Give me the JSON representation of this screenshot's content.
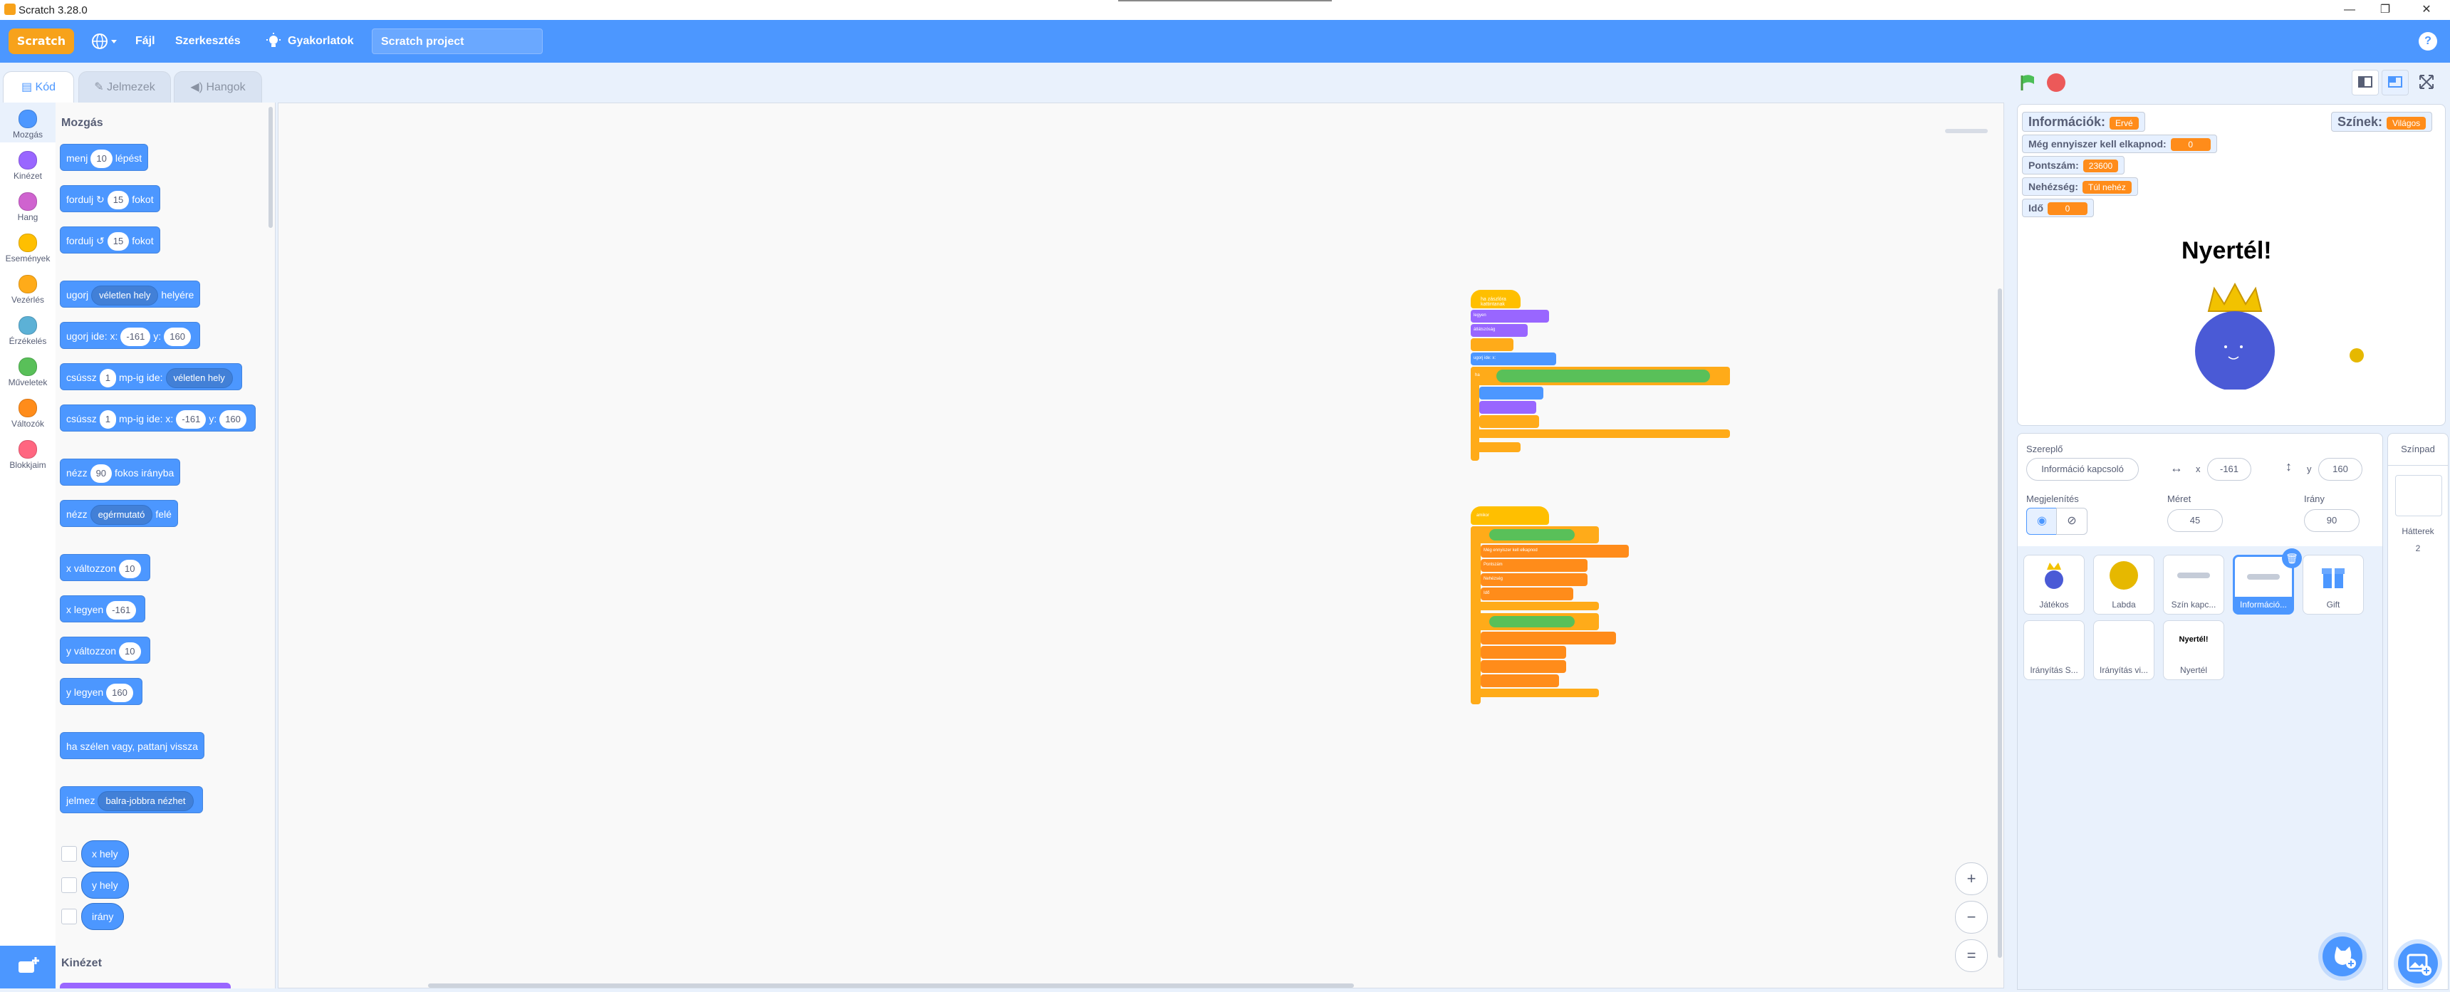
{
  "window": {
    "title": "Scratch 3.28.0",
    "min": "—",
    "max": "❐",
    "close": "✕"
  },
  "menu": {
    "logo": "Scratch",
    "file": "Fájl",
    "edit": "Szerkesztés",
    "tutorials": "Gyakorlatok",
    "project_title": "Scratch project",
    "help": "?"
  },
  "tabs": {
    "code": "Kód",
    "costumes": "Jelmezek",
    "sounds": "Hangok"
  },
  "categories": [
    {
      "label": "Mozgás",
      "color": "#4c97ff"
    },
    {
      "label": "Kinézet",
      "color": "#9966ff"
    },
    {
      "label": "Hang",
      "color": "#cf63cf"
    },
    {
      "label": "Események",
      "color": "#ffbf00"
    },
    {
      "label": "Vezérlés",
      "color": "#ffab19"
    },
    {
      "label": "Érzékelés",
      "color": "#5cb1d6"
    },
    {
      "label": "Műveletek",
      "color": "#59c059"
    },
    {
      "label": "Változók",
      "color": "#ff8c1a"
    },
    {
      "label": "Blokkjaim",
      "color": "#ff6680"
    }
  ],
  "palette": {
    "motion_heading": "Mozgás",
    "looks_heading": "Kinézet",
    "move": {
      "a": "menj",
      "n": "10",
      "b": "lépést"
    },
    "turn_right": {
      "a": "fordulj",
      "n": "15",
      "b": "fokot"
    },
    "turn_left": {
      "a": "fordulj",
      "n": "15",
      "b": "fokot"
    },
    "goto": {
      "a": "ugorj",
      "dd": "véletlen hely",
      "b": "helyére"
    },
    "goto_xy": {
      "a": "ugorj ide: x:",
      "x": "-161",
      "b": "y:",
      "y": "160"
    },
    "glide_to": {
      "a": "csússz",
      "n": "1",
      "b": "mp-ig ide:",
      "dd": "véletlen hely"
    },
    "glide_xy": {
      "a": "csússz",
      "n": "1",
      "b": "mp-ig ide: x:",
      "x": "-161",
      "c": "y:",
      "y": "160"
    },
    "point_dir": {
      "a": "nézz",
      "n": "90",
      "b": "fokos irányba"
    },
    "point_to": {
      "a": "nézz",
      "dd": "egérmutató",
      "b": "felé"
    },
    "change_x": {
      "a": "x változzon",
      "n": "10"
    },
    "set_x": {
      "a": "x legyen",
      "n": "-161"
    },
    "change_y": {
      "a": "y változzon",
      "n": "10"
    },
    "set_y": {
      "a": "y legyen",
      "n": "160"
    },
    "bounce": "ha szélen vagy, pattanj vissza",
    "rotation": {
      "a": "jelmez",
      "dd": "balra-jobbra nézhet"
    },
    "rep_x": "x hely",
    "rep_y": "y hely",
    "rep_dir": "irány"
  },
  "code": {
    "s1": [
      "ha zászlóra kattintanak",
      "legyen",
      "0",
      "szín",
      "háttér",
      "átlátszóság",
      "ugorj ide: x:",
      "y:",
      "mindig",
      "ha",
      "értékét",
      "és",
      "akkor",
      "nézz",
      "menj",
      "fordulj"
    ],
    "s2": [
      "amikor",
      "ha",
      "Még ennyiszer kell elkapnod",
      "Pontszám",
      "Nehézség",
      "Idő",
      "akkor"
    ]
  },
  "zoom": {
    "in": "+",
    "out": "−",
    "reset": "="
  },
  "stage": {
    "monitors": [
      {
        "label": "Információk:",
        "value": "Ervé"
      },
      {
        "label": "Színek:",
        "value": "Világos"
      },
      {
        "label": "Még ennyiszer kell elkapnod:",
        "value": "0"
      },
      {
        "label": "Pontszám:",
        "value": "23600"
      },
      {
        "label": "Nehézség:",
        "value": "Túl nehéz"
      },
      {
        "label": "Idő",
        "value": "0"
      }
    ],
    "win_text": "Nyertél!"
  },
  "sprite_info": {
    "sprite_label": "Szereplő",
    "sprite_name": "Információ kapcsoló",
    "x_label": "x",
    "x": "-161",
    "y_label": "y",
    "y": "160",
    "show_label": "Megjelenítés",
    "size_label": "Méret",
    "size": "45",
    "dir_label": "Irány",
    "dir": "90"
  },
  "sprites": [
    {
      "name": "Játékos"
    },
    {
      "name": "Labda"
    },
    {
      "name": "Szín kapc..."
    },
    {
      "name": "Információ..."
    },
    {
      "name": "Gift"
    },
    {
      "name": "Irányítás S..."
    },
    {
      "name": "Irányítás vi..."
    },
    {
      "name": "Nyertél"
    }
  ],
  "nyertel_thumb": "Nyertél!",
  "stage_pane": {
    "title": "Színpad",
    "backdrops_label": "Hátterek",
    "backdrops_count": "2"
  },
  "colors": {
    "accent": "#4c97ff",
    "events": "#ffbf00",
    "control": "#ffab19",
    "variables": "#ff8c1a",
    "operators": "#59c059"
  }
}
